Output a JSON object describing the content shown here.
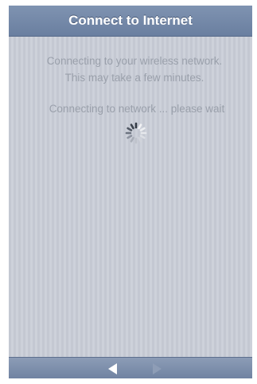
{
  "header": {
    "title": "Connect to Internet"
  },
  "status": {
    "line1": "Connecting to your wireless network.",
    "line2": "This may take a few minutes.",
    "progress": "Connecting to network ... please wait"
  },
  "footer": {
    "back_icon": "back-arrow-icon",
    "forward_icon": "forward-arrow-icon"
  },
  "colors": {
    "header": "#7489a8",
    "background": "#c7cbd5",
    "text": "#9aa0ab"
  }
}
